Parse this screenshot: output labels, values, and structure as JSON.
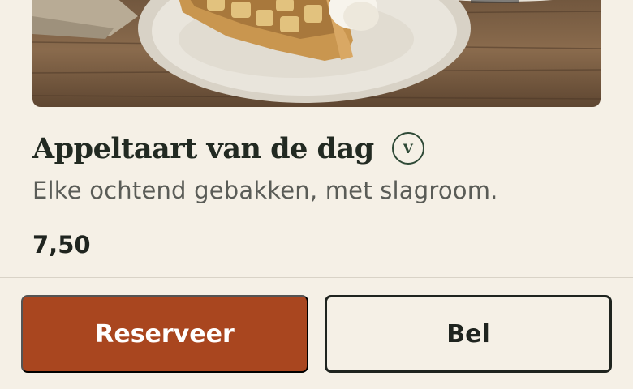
{
  "item": {
    "image_description_icon": "apple-pie-photo",
    "title": "Appeltaart van de dag",
    "badge": "V",
    "description": "Elke ochtend gebakken, met slagroom.",
    "price": "7,50"
  },
  "actions": {
    "reserve_label": "Reserveer",
    "call_label": "Bel"
  },
  "colors": {
    "background": "#f5f0e6",
    "primary": "#a9461f",
    "text": "#222a22",
    "badge": "#2f4a37"
  }
}
